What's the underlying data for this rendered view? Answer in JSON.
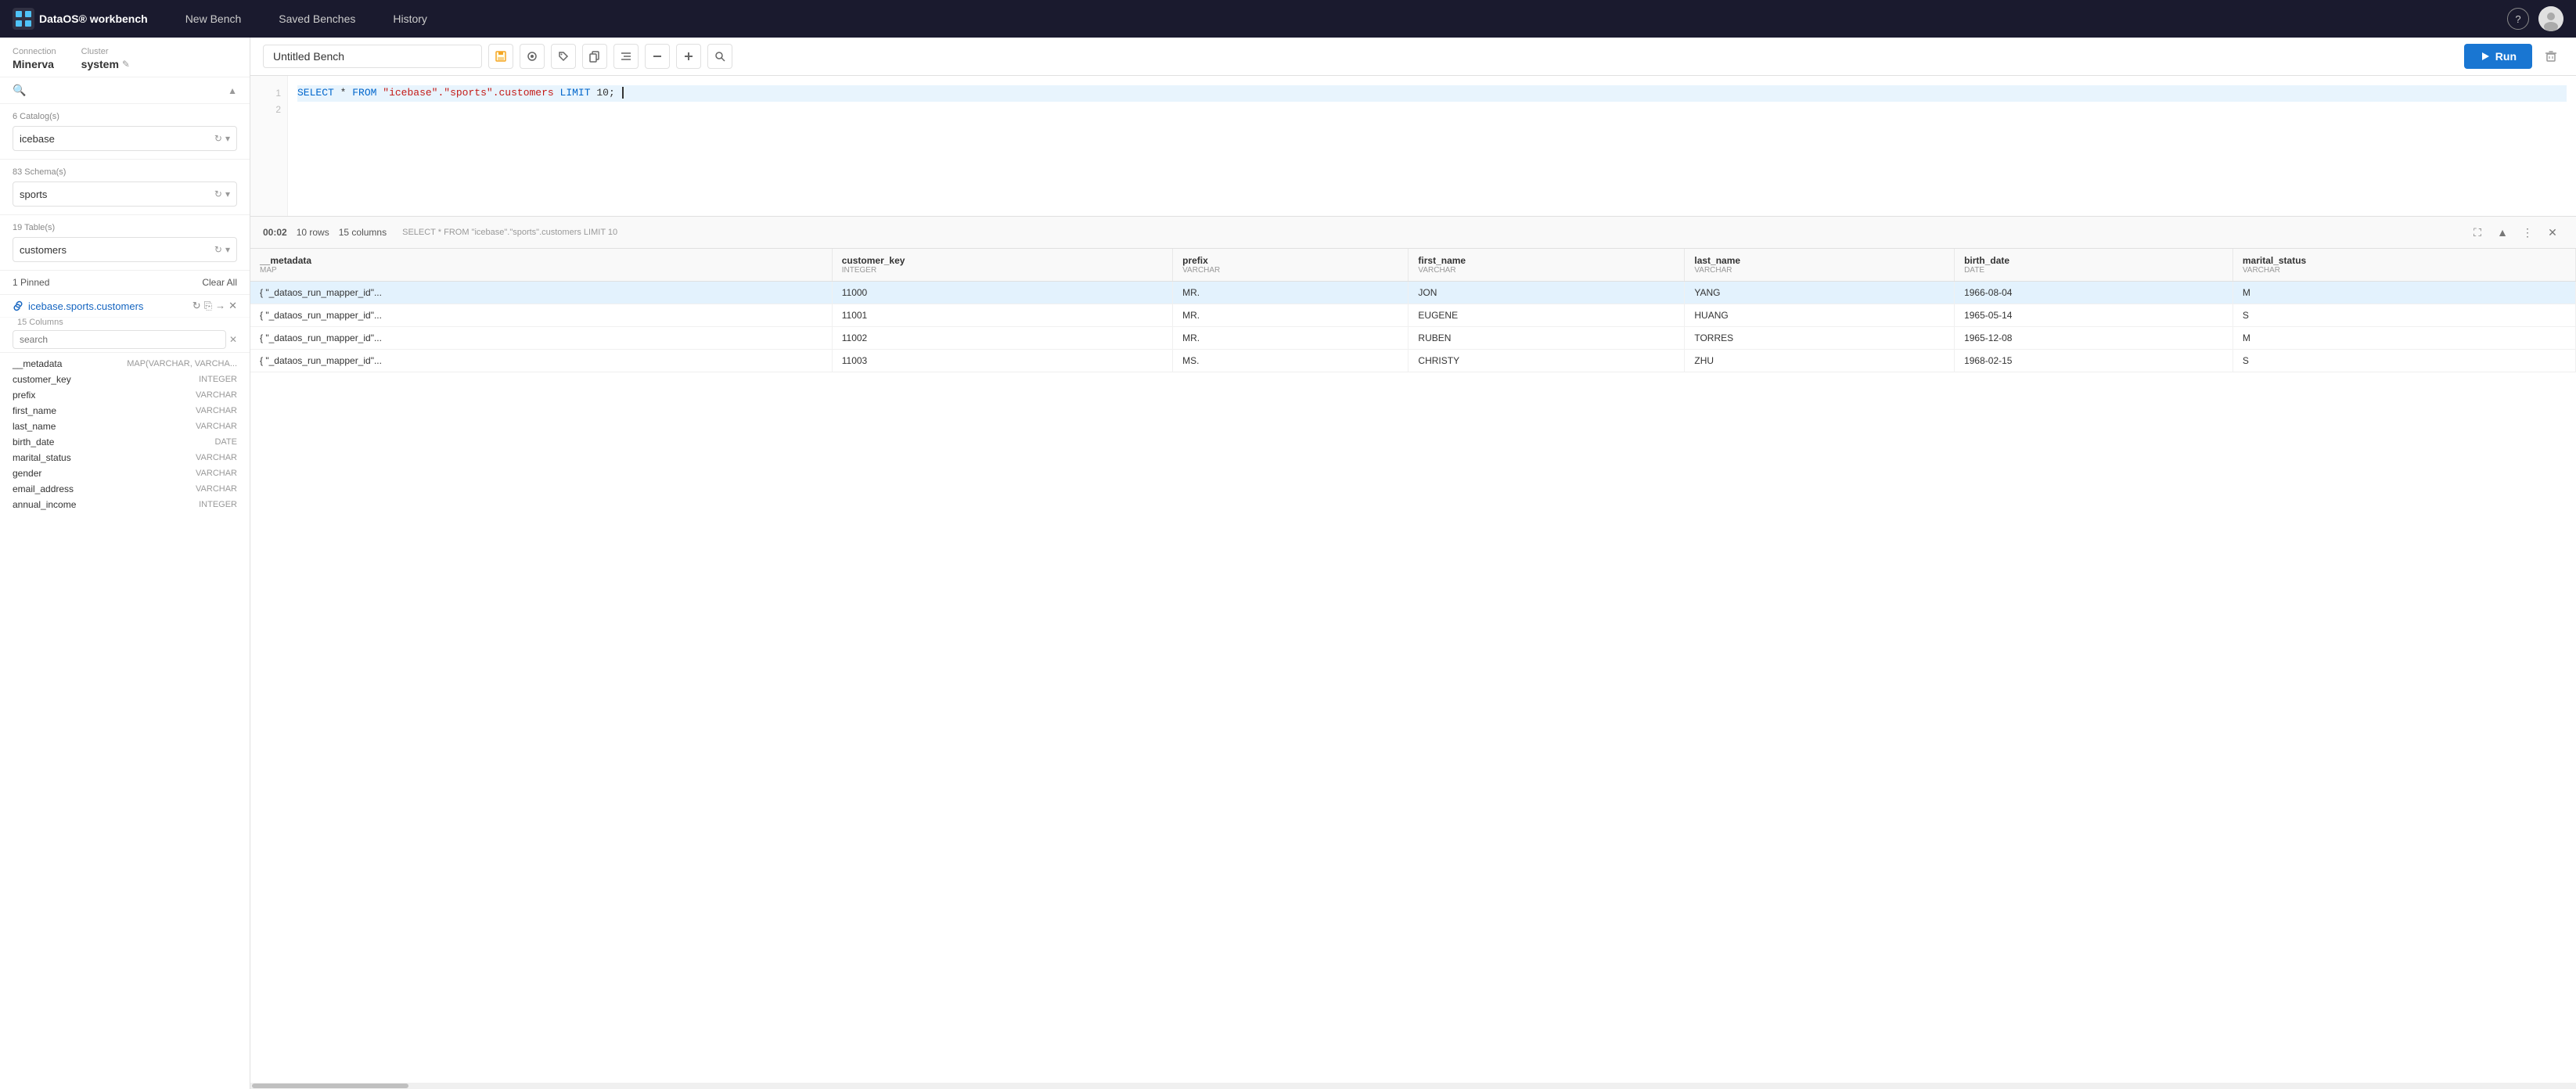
{
  "app": {
    "title": "DataOS® workbench"
  },
  "nav": {
    "new_bench": "New Bench",
    "saved_benches": "Saved Benches",
    "history": "History"
  },
  "connection": {
    "label": "Connection",
    "value": "Minerva",
    "cluster_label": "Cluster",
    "cluster_value": "system"
  },
  "sidebar": {
    "search_placeholder": "search",
    "catalog_label": "6 Catalog(s)",
    "catalog_value": "icebase",
    "schema_label": "83 Schema(s)",
    "schema_value": "sports",
    "table_label": "19 Table(s)",
    "table_value": "customers",
    "pinned_label": "1 Pinned",
    "clear_all": "Clear All",
    "pinned_item": "icebase.sports.customers",
    "columns_label": "15 Columns",
    "col_search_placeholder": "search",
    "columns": [
      {
        "name": "__metadata",
        "type": "MAP(VARCHAR, VARCHA..."
      },
      {
        "name": "customer_key",
        "type": "INTEGER"
      },
      {
        "name": "prefix",
        "type": "VARCHAR"
      },
      {
        "name": "first_name",
        "type": "VARCHAR"
      },
      {
        "name": "last_name",
        "type": "VARCHAR"
      },
      {
        "name": "birth_date",
        "type": "DATE"
      },
      {
        "name": "marital_status",
        "type": "VARCHAR"
      },
      {
        "name": "gender",
        "type": "VARCHAR"
      },
      {
        "name": "email_address",
        "type": "VARCHAR"
      },
      {
        "name": "annual_income",
        "type": "INTEGER"
      }
    ]
  },
  "bench": {
    "name": "Untitled Bench",
    "run_label": "Run",
    "sql_line1": "SELECT * FROM \"icebase\".\"sports\".customers LIMIT 10;",
    "sql_line2": ""
  },
  "results": {
    "timer": "00:02",
    "rows": "10 rows",
    "columns_count": "15 columns",
    "query_preview": "SELECT * FROM \"icebase\".\"sports\".customers LIMIT 10",
    "columns": [
      {
        "name": "__metadata",
        "type": "MAP"
      },
      {
        "name": "customer_key",
        "type": "INTEGER"
      },
      {
        "name": "prefix",
        "type": "VARCHAR"
      },
      {
        "name": "first_name",
        "type": "VARCHAR"
      },
      {
        "name": "last_name",
        "type": "VARCHAR"
      },
      {
        "name": "birth_date",
        "type": "DATE"
      },
      {
        "name": "marital_status",
        "type": "VARCHAR"
      }
    ],
    "rows_data": [
      {
        "metadata": "{ \"_dataos_run_mapper_id\"...",
        "customer_key": "11000",
        "prefix": "MR.",
        "first_name": "JON",
        "last_name": "YANG",
        "birth_date": "1966-08-04",
        "marital_status": "M"
      },
      {
        "metadata": "{ \"_dataos_run_mapper_id\"...",
        "customer_key": "11001",
        "prefix": "MR.",
        "first_name": "EUGENE",
        "last_name": "HUANG",
        "birth_date": "1965-05-14",
        "marital_status": "S"
      },
      {
        "metadata": "{ \"_dataos_run_mapper_id\"...",
        "customer_key": "11002",
        "prefix": "MR.",
        "first_name": "RUBEN",
        "last_name": "TORRES",
        "birth_date": "1965-12-08",
        "marital_status": "M"
      },
      {
        "metadata": "{ \"_dataos_run_mapper_id\"...",
        "customer_key": "11003",
        "prefix": "MS.",
        "first_name": "CHRISTY",
        "last_name": "ZHU",
        "birth_date": "1968-02-15",
        "marital_status": "S"
      }
    ]
  }
}
